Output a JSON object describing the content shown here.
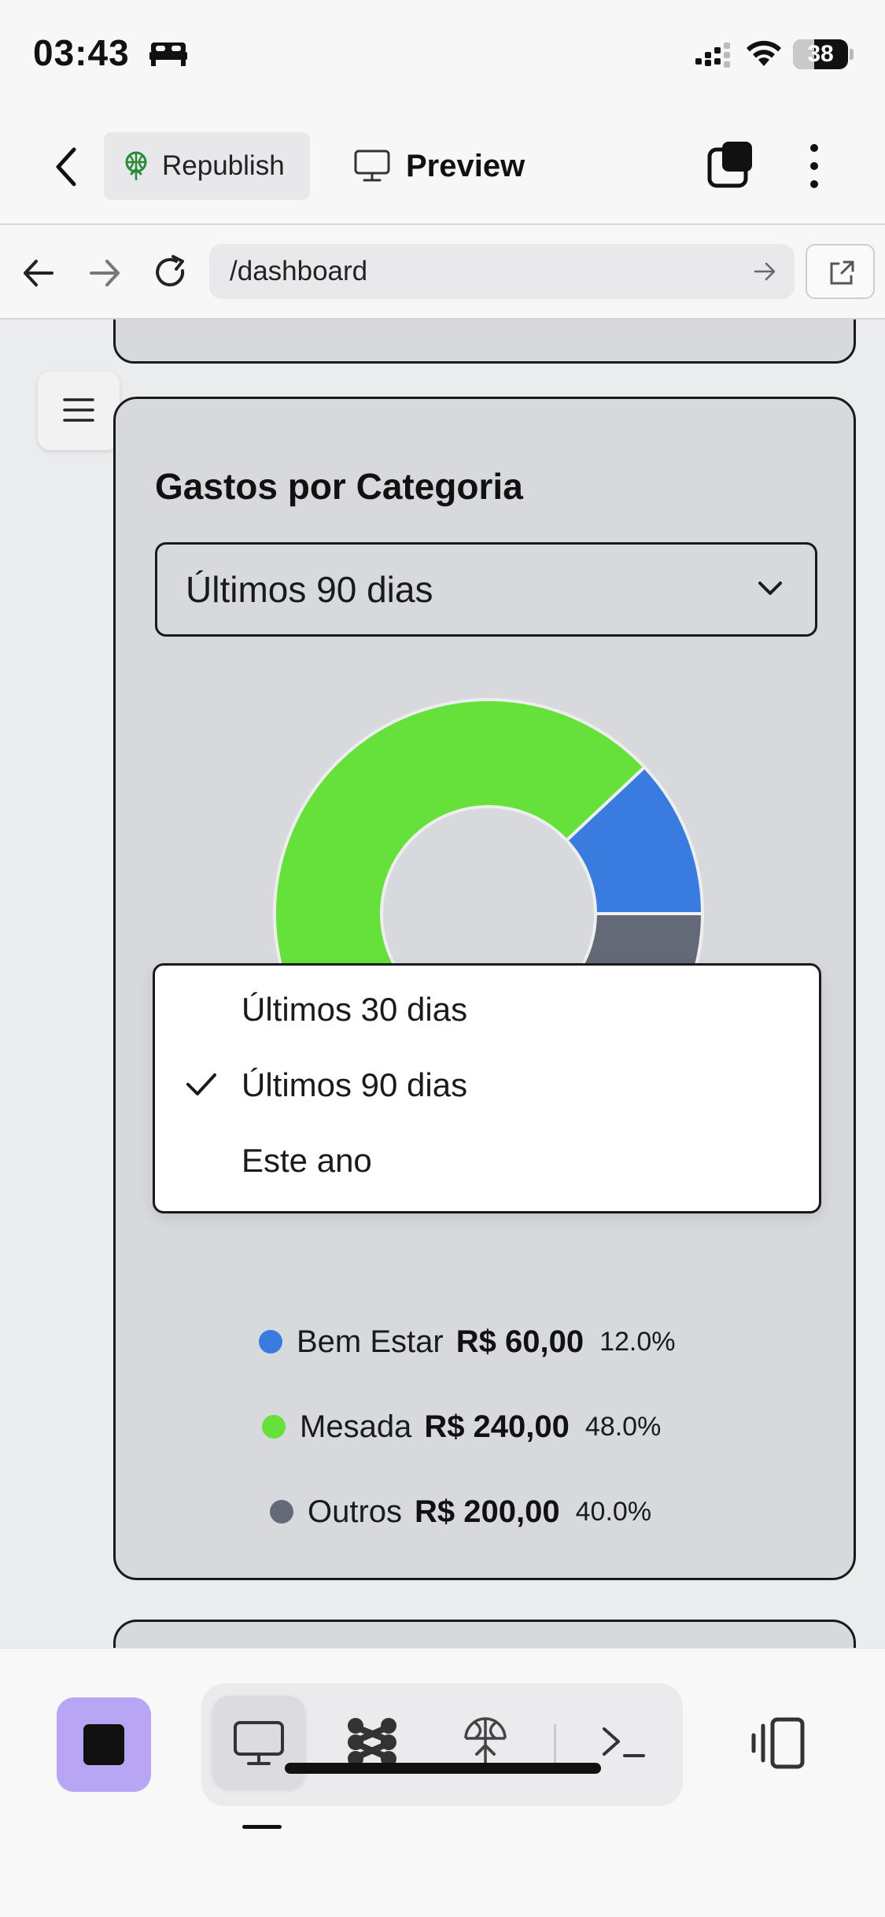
{
  "status_bar": {
    "time": "03:43",
    "battery": "38",
    "battery_level": 0.38,
    "icons": [
      "bed-icon",
      "cellular-signal-icon",
      "wifi-icon",
      "battery-icon"
    ]
  },
  "toolbar": {
    "back_icon": "chevron-left-icon",
    "republish_label": "Republish",
    "preview_label": "Preview",
    "icons": [
      "republish-icon",
      "monitor-icon",
      "layers-icon",
      "kebab-menu-icon"
    ]
  },
  "browser": {
    "url": "/dashboard",
    "icons": [
      "arrow-back-icon",
      "arrow-forward-icon",
      "reload-icon",
      "url-go-icon",
      "open-external-icon"
    ]
  },
  "card": {
    "title": "Gastos por Categoria",
    "period_select": {
      "value": "Últimos 90 dias",
      "options": [
        {
          "label": "Últimos 30 dias",
          "selected": false
        },
        {
          "label": "Últimos 90 dias",
          "selected": true
        },
        {
          "label": "Este ano",
          "selected": false
        }
      ]
    }
  },
  "chart_data": {
    "type": "pie",
    "title": "Gastos por Categoria",
    "donut": true,
    "slices": [
      {
        "name": "Bem Estar",
        "value": 60.0,
        "value_label": "R$ 60,00",
        "percent": 12.0,
        "percent_label": "12.0%",
        "color": "#3a7be0"
      },
      {
        "name": "Mesada",
        "value": 240.0,
        "value_label": "R$ 240,00",
        "percent": 48.0,
        "percent_label": "48.0%",
        "color": "#66e03a"
      },
      {
        "name": "Outros",
        "value": 200.0,
        "value_label": "R$ 200,00",
        "percent": 40.0,
        "percent_label": "40.0%",
        "color": "#636977"
      }
    ],
    "legend_position": "bottom"
  },
  "dock": {
    "tabs": [
      "monitor-icon",
      "workflow-icon",
      "deploy-icon",
      "terminal-icon"
    ],
    "active_tab": "monitor-icon",
    "colors": {
      "stop_button": "#b8a6f5"
    }
  }
}
